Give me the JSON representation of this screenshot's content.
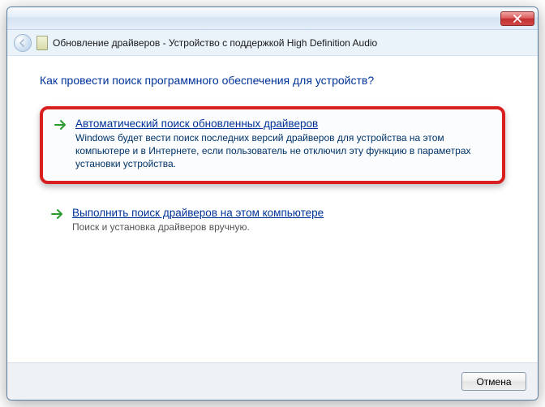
{
  "header": {
    "title": "Обновление драйверов - Устройство с поддержкой High Definition Audio"
  },
  "main": {
    "question": "Как провести поиск программного обеспечения для устройств?",
    "options": [
      {
        "title": "Автоматический поиск обновленных драйверов",
        "desc": "Windows будет вести поиск последних версий драйверов для устройства на этом компьютере и в Интернете, если пользователь не отключил эту функцию в параметрах установки устройства."
      },
      {
        "title": "Выполнить поиск драйверов на этом компьютере",
        "desc": "Поиск и установка драйверов вручную."
      }
    ]
  },
  "footer": {
    "cancel": "Отмена"
  }
}
